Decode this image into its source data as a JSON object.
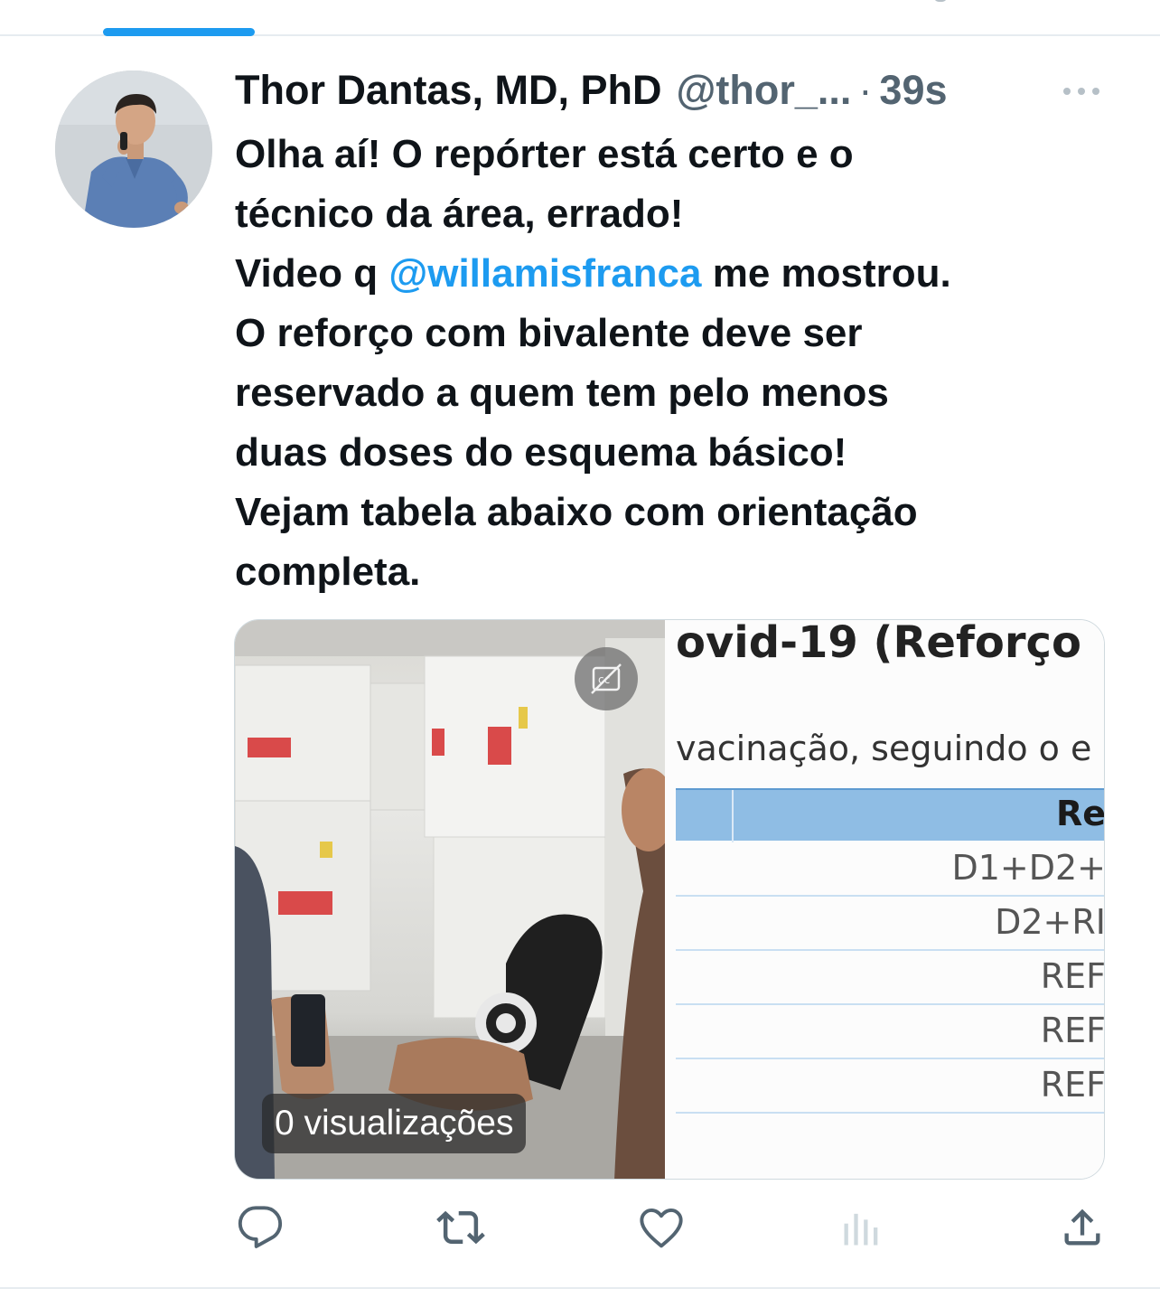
{
  "tweet": {
    "author_name": "Thor Dantas, MD, PhD",
    "author_handle": "@thor_...",
    "separator": "·",
    "timestamp": "39s",
    "text": {
      "line1": "Olha aí! O repórter está certo e o",
      "line2": "técnico da área, errado!",
      "line3_before": "Video q ",
      "mention": "@willamisfranca",
      "line3_after": " me mostrou.",
      "line4": "O reforço com bivalente deve ser",
      "line5": "reservado a quem tem pelo menos",
      "line6": "duas doses do esquema básico!",
      "line7": "Vejam tabela abaixo com orientação",
      "line8": "completa."
    }
  },
  "media": {
    "video": {
      "views_label": "0 visualizações"
    },
    "image": {
      "title": "ovid-19 (Reforço",
      "subtitle": "vacinação, seguindo o e",
      "header_cell": "Re",
      "rows": [
        "D1+D2+",
        "D2+RI",
        "REF",
        "REF",
        "REF"
      ]
    }
  },
  "icons": {
    "more": "more-horizontal-icon",
    "reply": "reply-icon",
    "retweet": "retweet-icon",
    "like": "heart-icon",
    "views": "analytics-icon",
    "share": "share-icon",
    "captions": "captions-off-icon"
  },
  "colors": {
    "accent": "#1d9bf0",
    "text": "#0f1419",
    "secondary": "#536471"
  }
}
